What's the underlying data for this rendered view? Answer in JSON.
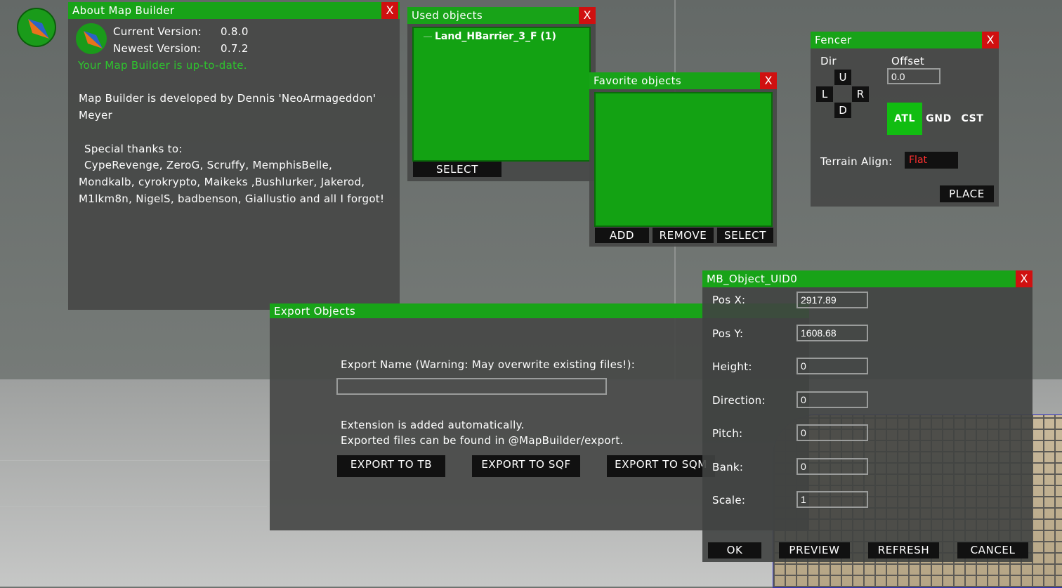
{
  "about": {
    "title": "About Map Builder",
    "close": "X",
    "current_label": "Current Version:",
    "current_value": "0.8.0",
    "newest_label": "Newest Version:",
    "newest_value": "0.7.2",
    "status": "Your Map Builder is up-to-date.",
    "dev_line1": "Map Builder is developed by Dennis 'NeoArmageddon'",
    "dev_line2": "Meyer",
    "thanks_header": "Special thanks to:",
    "thanks_line1": "CypeRevenge, ZeroG, Scruffy, MemphisBelle,",
    "thanks_line2": "Mondkalb, cyrokrypto, Maikeks ,Bushlurker, Jakerod,",
    "thanks_line3": "M1lkm8n, NigelS, badbenson, Giallustio and all I forgot!"
  },
  "used": {
    "title": "Used objects",
    "close": "X",
    "items": [
      "Land_HBarrier_3_F (1)"
    ],
    "select": "SELECT"
  },
  "favorite": {
    "title": "Favorite objects",
    "close": "X",
    "add": "ADD",
    "remove": "REMOVE",
    "select": "SELECT"
  },
  "fencer": {
    "title": "Fencer",
    "close": "X",
    "dir_label": "Dir",
    "up": "U",
    "left": "L",
    "right": "R",
    "down": "D",
    "offset_label": "Offset",
    "offset_value": "0.0",
    "modes": [
      "ATL",
      "GND",
      "CST"
    ],
    "active_mode": "ATL",
    "terrain_label": "Terrain Align:",
    "terrain_value": "Flat",
    "place": "PLACE"
  },
  "export": {
    "title": "Export Objects",
    "name_label": "Export Name (Warning: May overwrite existing files!):",
    "name_value": "",
    "info1": "Extension is added automatically.",
    "info2": "Exported files can be found in @MapBuilder/export.",
    "btn_tb": "EXPORT TO TB",
    "btn_sqf": "EXPORT TO SQF",
    "btn_sqm": "EXPORT TO SQM"
  },
  "object": {
    "title": "MB_Object_UID0",
    "close": "X",
    "fields": [
      {
        "label": "Pos X:",
        "value": "2917.89"
      },
      {
        "label": "Pos Y:",
        "value": "1608.68"
      },
      {
        "label": "Height:",
        "value": "0"
      },
      {
        "label": "Direction:",
        "value": "0"
      },
      {
        "label": "Pitch:",
        "value": "0"
      },
      {
        "label": "Bank:",
        "value": "0"
      },
      {
        "label": "Scale:",
        "value": "1"
      }
    ],
    "ok": "OK",
    "preview": "PREVIEW",
    "refresh": "REFRESH",
    "cancel": "CANCEL"
  },
  "colors": {
    "title_green": "#18a318",
    "close_red": "#d01010",
    "status_green": "#2ec52e",
    "flat_red": "#ff3030"
  }
}
